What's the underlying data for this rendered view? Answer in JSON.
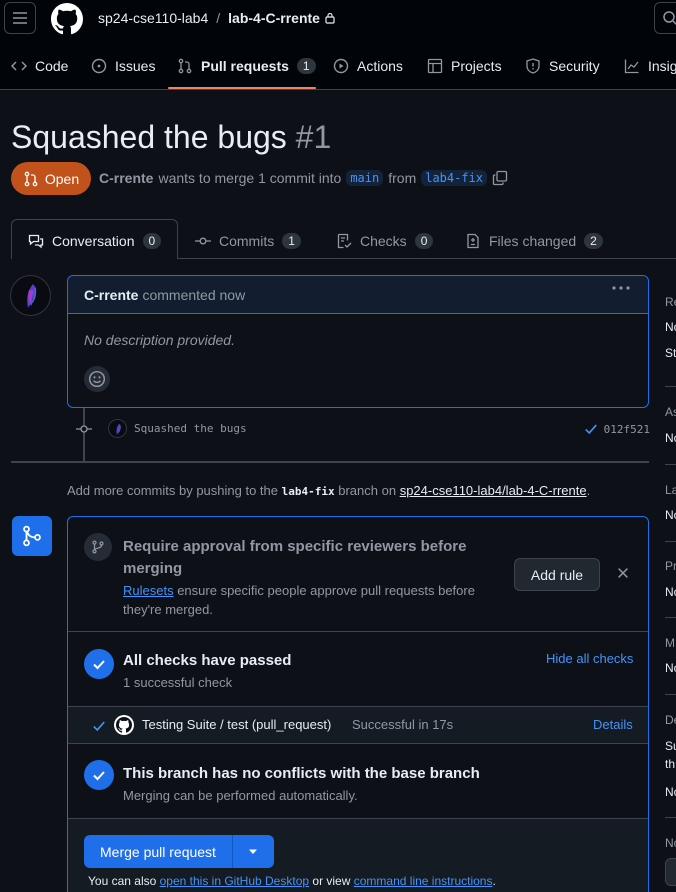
{
  "header": {
    "org": "sp24-cse110-lab4",
    "separator": "/",
    "repo": "lab-4-C-rrente"
  },
  "nav": {
    "items": [
      {
        "label": "Code",
        "icon": "code-icon"
      },
      {
        "label": "Issues",
        "icon": "issue-icon"
      },
      {
        "label": "Pull requests",
        "icon": "pull-request-icon",
        "count": "1",
        "active": true
      },
      {
        "label": "Actions",
        "icon": "play-icon"
      },
      {
        "label": "Projects",
        "icon": "table-icon"
      },
      {
        "label": "Security",
        "icon": "shield-icon"
      },
      {
        "label": "Insig",
        "icon": "graph-icon"
      }
    ]
  },
  "pr": {
    "title": "Squashed the bugs",
    "number": "#1",
    "state": "Open",
    "author": "C-rrente",
    "meta_text": "wants to merge 1 commit into",
    "base_branch": "main",
    "from_text": "from",
    "head_branch": "lab4-fix"
  },
  "tabs": [
    {
      "label": "Conversation",
      "count": "0",
      "icon": "comment-discussion-icon"
    },
    {
      "label": "Commits",
      "count": "1",
      "icon": "git-commit-icon"
    },
    {
      "label": "Checks",
      "count": "0",
      "icon": "checklist-icon"
    },
    {
      "label": "Files changed",
      "count": "2",
      "icon": "file-diff-icon"
    }
  ],
  "comment": {
    "author": "C-rrente",
    "action": "commented now",
    "body": "No description provided."
  },
  "commit": {
    "message": "Squashed the bugs",
    "sha": "012f521"
  },
  "push_note": {
    "prefix": "Add more commits by pushing to the",
    "branch": "lab4-fix",
    "middle": "branch on",
    "repo": "sp24-cse110-lab4/lab-4-C-rrente",
    "suffix": "."
  },
  "merge_box": {
    "rule": {
      "title": "Require approval from specific reviewers before merging",
      "link": "Rulesets",
      "desc": "ensure specific people approve pull requests before they're merged.",
      "button": "Add rule"
    },
    "checks": {
      "title": "All checks have passed",
      "sub": "1 successful check",
      "toggle": "Hide all checks"
    },
    "check_row": {
      "name": "Testing Suite / test (pull_request)",
      "status": "Successful in 17s",
      "details": "Details"
    },
    "conflicts": {
      "title": "This branch has no conflicts with the base branch",
      "sub": "Merging can be performed automatically."
    },
    "merge_button": "Merge pull request",
    "also": {
      "prefix": "You can also",
      "link1": "open this in GitHub Desktop",
      "middle": "or view",
      "link2": "command line instructions",
      "suffix": "."
    }
  },
  "sidebar": {
    "items": [
      "Re",
      "No",
      "St",
      "As",
      "No",
      "La",
      "No",
      "Pr",
      "No",
      "M",
      "No",
      "De",
      "Su",
      "th",
      "No",
      "No"
    ]
  },
  "colors": {
    "accent": "#1f6feb",
    "open_state": "#c2521c",
    "tab_underline": "#f78166",
    "background": "#0d1117"
  }
}
